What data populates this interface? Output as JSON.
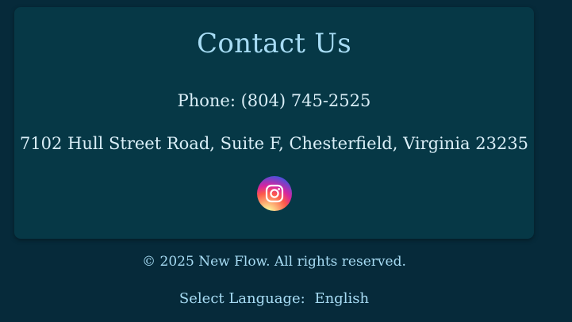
{
  "contact": {
    "title": "Contact Us",
    "phone": "Phone: (804) 745-2525",
    "address": "7102 Hull Street Road, Suite F, Chesterfield, Virginia 23235",
    "social": {
      "icon": "instagram-icon"
    }
  },
  "footer": {
    "copyright": "© 2025 New Flow. All rights reserved.",
    "language_label": "Select Language:",
    "language_value": "English"
  },
  "colors": {
    "background": "#062a3a",
    "card": "#063846",
    "heading": "#a7dcf4"
  }
}
